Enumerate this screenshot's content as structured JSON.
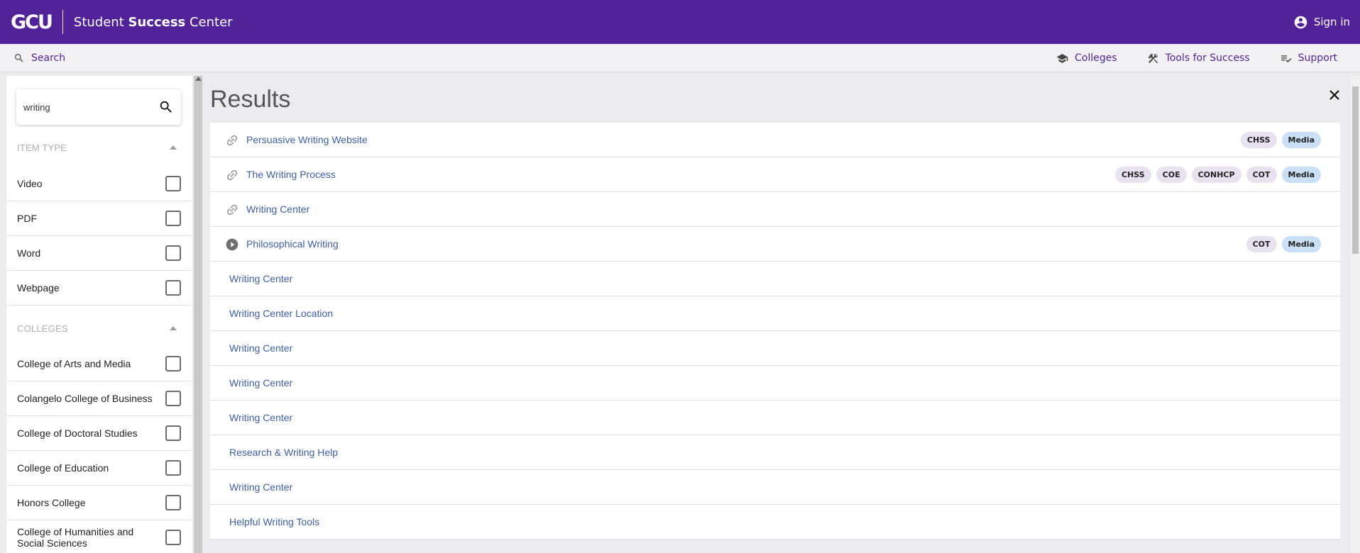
{
  "header": {
    "logo": "GCU",
    "title_prefix": "Student ",
    "title_bold": "Success",
    "title_suffix": " Center",
    "signin_label": "Sign in",
    "brand_color": "#522398"
  },
  "subnav": {
    "search_label": "Search",
    "items": [
      {
        "label": "Colleges",
        "icon": "graduation-cap-icon"
      },
      {
        "label": "Tools for Success",
        "icon": "tools-icon"
      },
      {
        "label": "Support",
        "icon": "playlist-check-icon"
      }
    ]
  },
  "sidebar": {
    "search_value": "writing",
    "item_type_heading": "ITEM TYPE",
    "item_types": [
      "Video",
      "PDF",
      "Word",
      "Webpage"
    ],
    "colleges_heading": "COLLEGES",
    "colleges": [
      "College of Arts and Media",
      "Colangelo College of Business",
      "College of Doctoral Studies",
      "College of Education",
      "Honors College",
      "College of Humanities and Social Sciences"
    ]
  },
  "results": {
    "title": "Results",
    "items": [
      {
        "label": "Persuasive Writing Website",
        "icon": "link-icon",
        "tags": [
          "CHSS",
          "Media"
        ]
      },
      {
        "label": "The Writing Process",
        "icon": "link-icon",
        "tags": [
          "CHSS",
          "COE",
          "CONHCP",
          "COT",
          "Media"
        ]
      },
      {
        "label": "Writing Center",
        "icon": "link-icon",
        "tags": []
      },
      {
        "label": "Philosophical Writing",
        "icon": "play-circle-icon",
        "tags": [
          "COT",
          "Media"
        ]
      },
      {
        "label": "Writing Center",
        "icon": "",
        "tags": []
      },
      {
        "label": "Writing Center Location",
        "icon": "",
        "tags": []
      },
      {
        "label": "Writing Center",
        "icon": "",
        "tags": []
      },
      {
        "label": "Writing Center",
        "icon": "",
        "tags": []
      },
      {
        "label": "Writing Center",
        "icon": "",
        "tags": []
      },
      {
        "label": "Research & Writing Help",
        "icon": "",
        "tags": []
      },
      {
        "label": "Writing Center",
        "icon": "",
        "tags": []
      },
      {
        "label": "Helpful Writing Tools",
        "icon": "",
        "tags": []
      }
    ]
  }
}
